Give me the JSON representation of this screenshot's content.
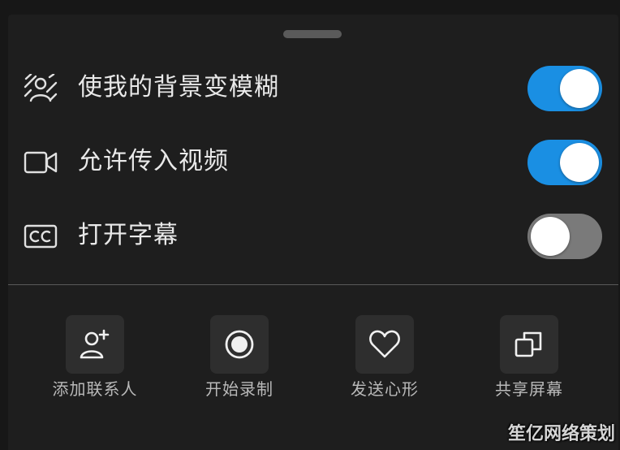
{
  "settings": [
    {
      "icon": "blur-background-icon",
      "label": "使我的背景变模糊",
      "enabled": true
    },
    {
      "icon": "video-camera-icon",
      "label": "允许传入视频",
      "enabled": true
    },
    {
      "icon": "closed-captions-icon",
      "label": "打开字幕",
      "enabled": false
    }
  ],
  "actions": [
    {
      "icon": "add-contact-icon",
      "label": "添加联系人"
    },
    {
      "icon": "record-icon",
      "label": "开始录制"
    },
    {
      "icon": "heart-icon",
      "label": "发送心形"
    },
    {
      "icon": "share-screen-icon",
      "label": "共享屏幕"
    }
  ],
  "watermark": "笙亿网络策划",
  "colors": {
    "toggle_on": "#1a8fe3",
    "toggle_off": "#7a7a7a",
    "background": "#1e1e1e",
    "tile": "#2e2e2e"
  }
}
